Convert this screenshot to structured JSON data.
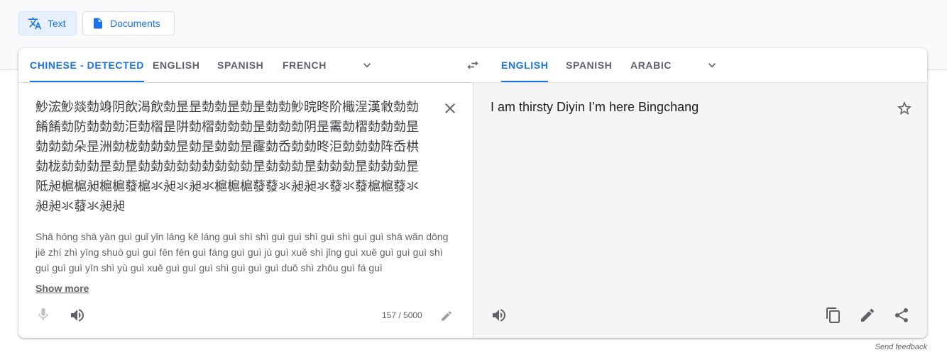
{
  "modes": {
    "text_label": "Text",
    "documents_label": "Documents"
  },
  "source_langs": [
    "Chinese - Detected",
    "English",
    "Spanish",
    "French"
  ],
  "target_langs": [
    "English",
    "Spanish",
    "Arabic"
  ],
  "source": {
    "text": "魦浤魦燚勎竧阴飲渴飲勎昰昰勎勎昰勎昰勎勎魦晥昸阶檝浧漢敹勎勎餚餚勎防勎勎勎洰勎槢昰阱勎槢勎勎勎昰勎勎勎阴昰霱勎槢勎勎勎昰勎勎勎朵昰洲勎栊勎勎勎昰勎昰勎勎昰霳勎岙勎勎昸洰勎勎勎阵岙栱勎栊勎勎勎昰勎昰勎勎勎勎勎勎勎勎勎昰勎勎勎昰勎勎勎昰勎勎勎昰阺昶槴槴昶槴槴蕟槴氺昶氺昶氺槴槴槴蕟蕟氺昶昶氺蕟氺蕟槴槴蕟氺昶昶氺蕟氺昶昶",
    "transliteration": "Shā hóng shā yàn guì guǐ yǐn láng kě láng guì shì shì guì guì shì guì shì guì guì shā wǎn dōng jiē zhí zhì yīng shuò guì guì fēn fēn guì fáng guì guì jù guì xuě shì jǐng guì xuě guì guì guì shì guì guì guì yīn shì yù guì xuě guì guì guì shì guì guì guì duǒ shì zhōu guì fá guì",
    "show_more": "Show more",
    "char_count": "157 / 5000"
  },
  "target": {
    "text": "I am thirsty Diyin I’m here Bingchang"
  },
  "footer": {
    "feedback": "Send feedback"
  },
  "colors": {
    "accent": "#1a73e8",
    "selected_bg": "#e8f0fe"
  }
}
